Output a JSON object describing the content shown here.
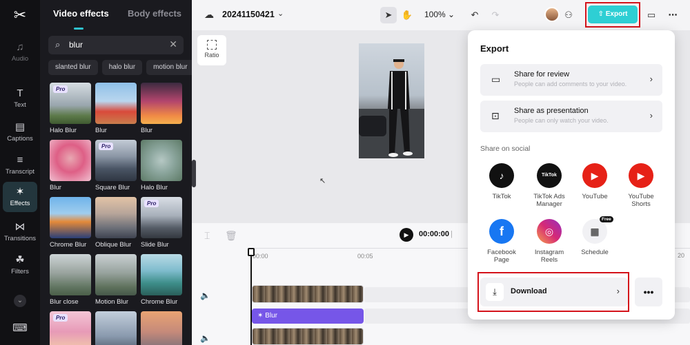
{
  "rail": {
    "items": [
      {
        "label": "Audio",
        "icon": "music-note-icon"
      },
      {
        "label": "Text",
        "icon": "text-t-icon"
      },
      {
        "label": "Captions",
        "icon": "captions-icon"
      },
      {
        "label": "Transcript",
        "icon": "transcript-icon"
      },
      {
        "label": "Effects",
        "icon": "sparkle-icon"
      },
      {
        "label": "Transitions",
        "icon": "bowtie-icon"
      },
      {
        "label": "Filters",
        "icon": "filters-icon"
      }
    ]
  },
  "panel": {
    "tabs": [
      "Video effects",
      "Body effects"
    ],
    "search": {
      "value": "blur"
    },
    "chips": [
      "slanted blur",
      "halo blur",
      "motion blur"
    ],
    "pro_badge": "Pro",
    "effects": [
      {
        "label": "Halo Blur",
        "pro": true
      },
      {
        "label": "Blur",
        "pro": false
      },
      {
        "label": "Blur",
        "pro": false
      },
      {
        "label": "Blur",
        "pro": false
      },
      {
        "label": "Square Blur",
        "pro": true
      },
      {
        "label": "Halo Blur",
        "pro": false
      },
      {
        "label": "Chrome Blur",
        "pro": false
      },
      {
        "label": "Oblique Blur",
        "pro": false
      },
      {
        "label": "Slide Blur",
        "pro": true
      },
      {
        "label": "Blur close",
        "pro": false
      },
      {
        "label": "Motion Blur",
        "pro": false
      },
      {
        "label": "Chrome Blur",
        "pro": false
      },
      {
        "label": "",
        "pro": true
      },
      {
        "label": "",
        "pro": false
      },
      {
        "label": "",
        "pro": false
      }
    ]
  },
  "topbar": {
    "project_name": "20241150421",
    "zoom": "100%",
    "export_label": "Export"
  },
  "canvas": {
    "ratio_label": "Ratio"
  },
  "timeline": {
    "timecode": "00:00:00",
    "separator": "|",
    "ruler": [
      "00:00",
      "00:05"
    ],
    "right_tick": "20",
    "effect_clip_label": "Blur"
  },
  "export_dialog": {
    "title": "Export",
    "share_rows": [
      {
        "title": "Share for review",
        "subtitle": "People can add comments to your video.",
        "icon": "comment-icon"
      },
      {
        "title": "Share as presentation",
        "subtitle": "People can only watch your video.",
        "icon": "presentation-icon"
      }
    ],
    "social_title": "Share on social",
    "social": [
      {
        "label": "TikTok",
        "icon": "tiktok-icon",
        "color": "#111111",
        "glyph": "♪"
      },
      {
        "label": "TikTok Ads Manager",
        "icon": "tiktok-ads-icon",
        "color": "#111111",
        "glyph": "TikTok"
      },
      {
        "label": "YouTube",
        "icon": "youtube-icon",
        "color": "#e62117",
        "glyph": "▶"
      },
      {
        "label": "YouTube Shorts",
        "icon": "youtube-shorts-icon",
        "color": "#e62117",
        "glyph": "▶"
      },
      {
        "label": "Facebook Page",
        "icon": "facebook-icon",
        "color": "#1877f2",
        "glyph": "f"
      },
      {
        "label": "Instagram Reels",
        "icon": "instagram-icon",
        "color": "#d62976",
        "glyph": "◎"
      },
      {
        "label": "Schedule",
        "icon": "calendar-icon",
        "color": "#f1f1f4",
        "glyph": "▦"
      }
    ],
    "free_badge": "Free",
    "download_label": "Download",
    "more_label": "•••"
  },
  "colors": {
    "accent": "#2ecfd4",
    "highlight_frame": "#d4121a",
    "effect_clip": "#7656e8",
    "rail_bg": "#111114",
    "panel_bg": "#1a1a1f"
  }
}
